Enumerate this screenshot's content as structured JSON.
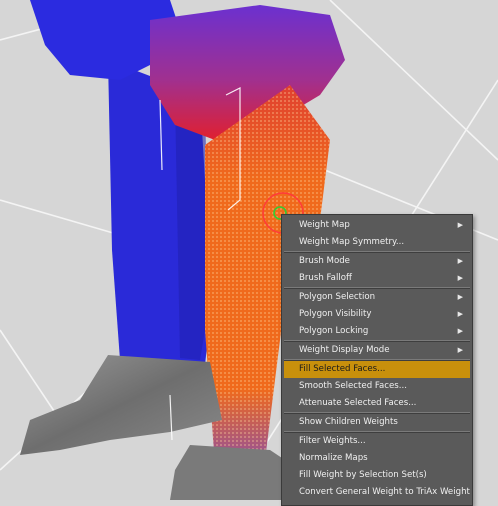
{
  "menu": {
    "submenu_glyph": "▶",
    "groups": [
      [
        {
          "label": "Weight Map",
          "submenu": true
        },
        {
          "label": "Weight Map Symmetry...",
          "submenu": false
        }
      ],
      [
        {
          "label": "Brush Mode",
          "submenu": true
        },
        {
          "label": "Brush Falloff",
          "submenu": true
        }
      ],
      [
        {
          "label": "Polygon Selection",
          "submenu": true
        },
        {
          "label": "Polygon Visibility",
          "submenu": true
        },
        {
          "label": "Polygon Locking",
          "submenu": true
        }
      ],
      [
        {
          "label": "Weight Display Mode",
          "submenu": true
        }
      ],
      [
        {
          "label": "Fill Selected Faces...",
          "submenu": false,
          "highlighted": true
        },
        {
          "label": "Smooth Selected Faces...",
          "submenu": false
        },
        {
          "label": "Attenuate Selected Faces...",
          "submenu": false
        }
      ],
      [
        {
          "label": "Show Children Weights",
          "submenu": false
        }
      ],
      [
        {
          "label": "Filter Weights...",
          "submenu": false
        },
        {
          "label": "Normalize Maps",
          "submenu": false
        },
        {
          "label": "Fill Weight by Selection Set(s)",
          "submenu": false
        },
        {
          "label": "Convert General Weight to TriAx Weight",
          "submenu": false
        }
      ]
    ]
  },
  "colors": {
    "highlight": "#c8900c",
    "menu_bg": "#5a5a5a",
    "weight_blue": "#2a2ad8",
    "weight_red": "#e02020",
    "weight_orange": "#ee6a18"
  }
}
